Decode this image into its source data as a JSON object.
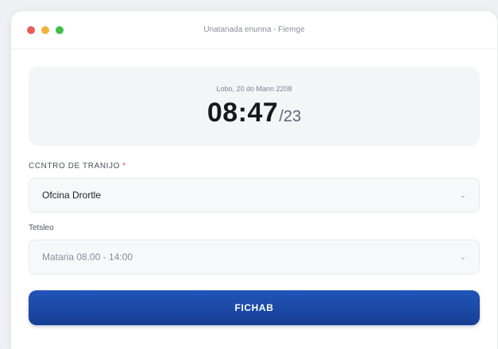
{
  "window": {
    "title": "Unatanada enunna - Fiemge",
    "controls": [
      "close",
      "minimize",
      "zoom"
    ],
    "control_colors": {
      "close": "#e95c55",
      "minimize": "#efb53b",
      "zoom": "#42bd4a"
    }
  },
  "clock": {
    "date": "Lobo, 20 do Mann 2208",
    "hours_minutes": "08:47",
    "seconds": "/23"
  },
  "form": {
    "work_center": {
      "label": "CCNTRO DE TRANIJO",
      "required_marker": "*",
      "value": "Ofcina Drortle",
      "icon": "chevron-down-icon"
    },
    "shift": {
      "label": "Tetsleo",
      "value": "Mataria 08.00 - 14:00",
      "icon": "chevron-down-icon"
    },
    "submit_label": "FICHAB"
  },
  "colors": {
    "accent": "#1c4aa8",
    "required": "#e24b4b"
  }
}
